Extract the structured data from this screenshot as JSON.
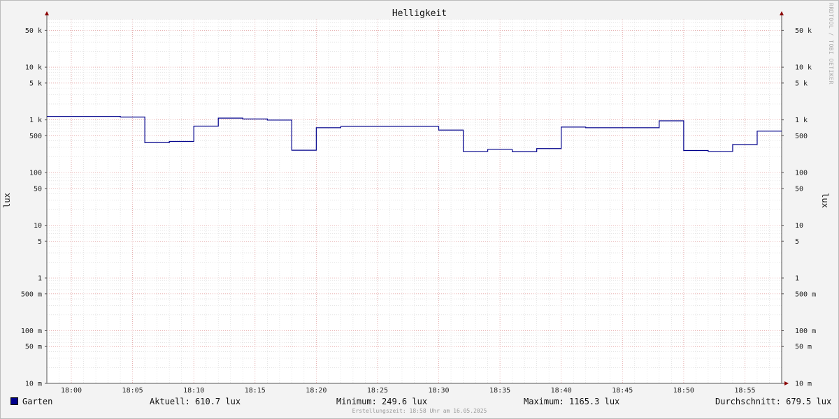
{
  "chart_data": {
    "type": "line",
    "title": "Helligkeit",
    "ylabel": "lux",
    "y_scale": "log",
    "ylim": [
      0.01,
      80000
    ],
    "xlim": [
      "17:58:00",
      "17:58:00+60m"
    ],
    "y_ticks": [
      {
        "v": 50000,
        "label": "50 k"
      },
      {
        "v": 10000,
        "label": "10 k"
      },
      {
        "v": 5000,
        "label": "5 k"
      },
      {
        "v": 1000,
        "label": "1 k"
      },
      {
        "v": 500,
        "label": "500"
      },
      {
        "v": 100,
        "label": "100"
      },
      {
        "v": 50,
        "label": "50"
      },
      {
        "v": 10,
        "label": "10"
      },
      {
        "v": 5,
        "label": "5"
      },
      {
        "v": 1,
        "label": "1"
      },
      {
        "v": 0.5,
        "label": "500 m"
      },
      {
        "v": 0.1,
        "label": "100 m"
      },
      {
        "v": 0.05,
        "label": "50 m"
      },
      {
        "v": 0.01,
        "label": "10 m"
      }
    ],
    "x_ticks": [
      "18:00",
      "18:05",
      "18:10",
      "18:15",
      "18:20",
      "18:25",
      "18:30",
      "18:35",
      "18:40",
      "18:45",
      "18:50",
      "18:55"
    ],
    "grid": true,
    "series": [
      {
        "name": "Garten",
        "color": "#00008b",
        "points": [
          [
            "17:58",
            1165.3
          ],
          [
            "18:04",
            1130
          ],
          [
            "18:06",
            370
          ],
          [
            "18:08",
            390
          ],
          [
            "18:10",
            760
          ],
          [
            "18:12",
            1080
          ],
          [
            "18:14",
            1040
          ],
          [
            "18:16",
            990
          ],
          [
            "18:18",
            265
          ],
          [
            "18:20",
            710
          ],
          [
            "18:22",
            750
          ],
          [
            "18:24",
            750
          ],
          [
            "18:26",
            750
          ],
          [
            "18:28",
            750
          ],
          [
            "18:30",
            640
          ],
          [
            "18:32",
            252
          ],
          [
            "18:34",
            275
          ],
          [
            "18:36",
            249.6
          ],
          [
            "18:38",
            285
          ],
          [
            "18:40",
            730
          ],
          [
            "18:42",
            710
          ],
          [
            "18:44",
            710
          ],
          [
            "18:46",
            710
          ],
          [
            "18:48",
            960
          ],
          [
            "18:50",
            262
          ],
          [
            "18:52",
            252
          ],
          [
            "18:54",
            340
          ],
          [
            "18:56",
            610.7
          ]
        ],
        "end": "18:58"
      }
    ]
  },
  "legend": {
    "series_name": "Garten",
    "series_color": "#00008b",
    "current": "Aktuell: 610.7 lux",
    "minimum": "Minimum: 249.6 lux",
    "maximum": "Maximum: 1165.3 lux",
    "average": "Durchschnitt: 679.5 lux"
  },
  "footer": "Erstellungszeit: 18:58 Uhr am 16.05.2025",
  "watermark": "RRDTOOL / TOBI OETIKER"
}
